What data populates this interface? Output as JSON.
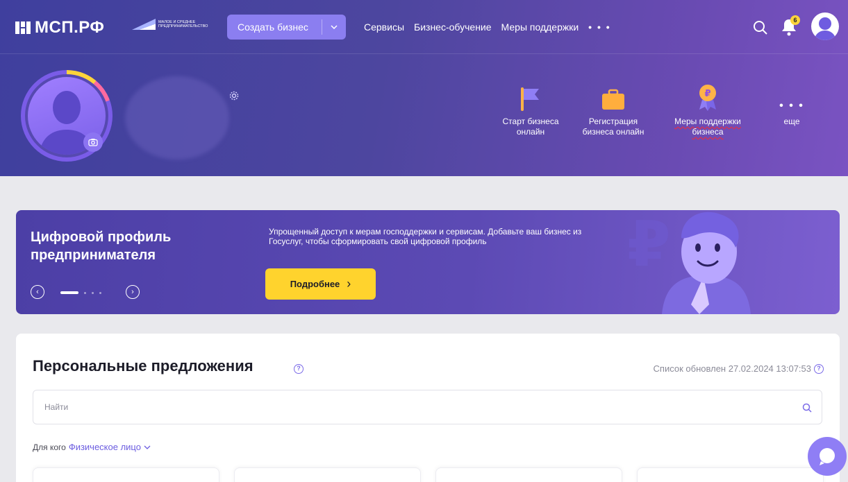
{
  "header": {
    "logo_text": "МСП.РФ",
    "logo_subtitle": "МАЛОЕ И СРЕДНЕЕ ПРЕДПРИНИМАТЕЛЬСТВО",
    "create_button": "Создать бизнес",
    "nav": [
      "Сервисы",
      "Бизнес-обучение",
      "Меры поддержки"
    ],
    "nav_more": "• • •",
    "notifications_count": "6"
  },
  "profile": {
    "quick_actions": [
      {
        "label": "Старт бизнеса онлайн",
        "icon": "flag-icon"
      },
      {
        "label": "Регистрация бизнеса онлайн",
        "icon": "briefcase-icon"
      },
      {
        "label": "Меры поддержки бизнеса",
        "icon": "ruble-medal-icon"
      },
      {
        "label": "еще",
        "icon": "more-dots-icon"
      }
    ],
    "more_dots": "• • •"
  },
  "banner": {
    "title": "Цифровой профиль предпринимателя",
    "description": "Упрощенный доступ к мерам господдержки и сервисам. Добавьте ваш бизнес из Госуслуг, чтобы сформировать свой цифровой профиль",
    "button": "Подробнее",
    "button_arrow": "›",
    "prev": "‹",
    "next": "›"
  },
  "offers": {
    "title": "Персональные предложения",
    "help": "?",
    "updated": "Список обновлен 27.02.2024 13:07:53",
    "search_placeholder": "Найти",
    "filter_label": "Для кого",
    "filter_value": "Физическое лицо"
  },
  "colors": {
    "accent": "#8b7ef0",
    "yellow": "#ffd32d",
    "header_dark": "#3f3f9e",
    "header_light": "#7a53c2"
  }
}
